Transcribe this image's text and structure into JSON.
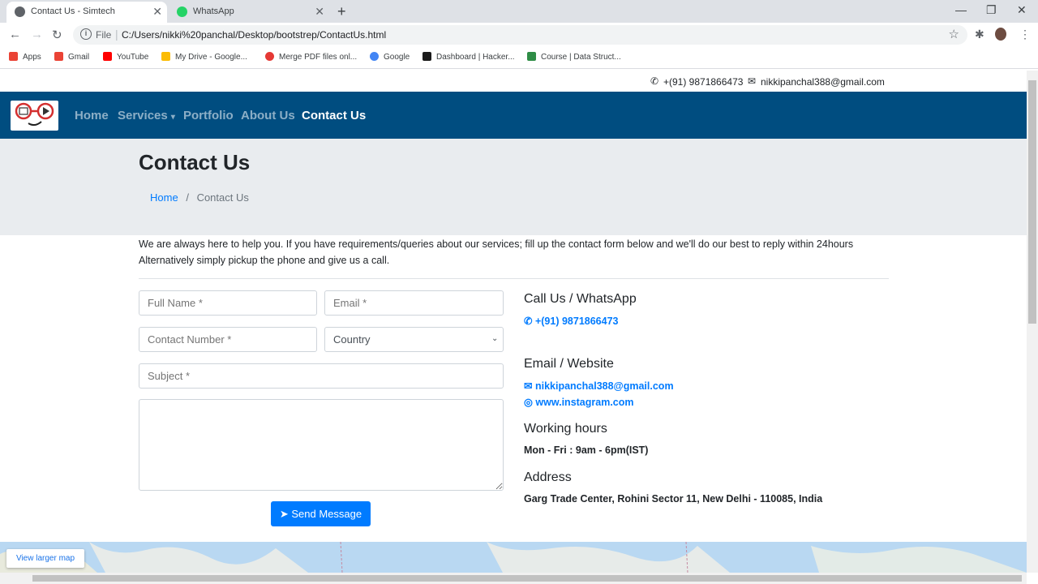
{
  "browser": {
    "tabs": [
      {
        "title": "Contact Us - Simtech",
        "active": true
      },
      {
        "title": "WhatsApp",
        "active": false
      }
    ],
    "url_scheme": "File",
    "url": "C:/Users/nikki%20panchal/Desktop/bootstrep/ContactUs.html",
    "bookmarks": [
      {
        "label": "Apps",
        "icon": "apps-grid-icon",
        "color": "#ea4335"
      },
      {
        "label": "Gmail",
        "icon": "gmail-icon",
        "color": "#ea4335"
      },
      {
        "label": "YouTube",
        "icon": "youtube-icon",
        "color": "#ff0000"
      },
      {
        "label": "My Drive - Google...",
        "icon": "google-drive-icon",
        "color": "#fbbc04"
      },
      {
        "label": "Merge PDF files onl...",
        "icon": "heart-icon",
        "color": "#e53935"
      },
      {
        "label": "Google",
        "icon": "google-icon",
        "color": "#4285f4"
      },
      {
        "label": "Dashboard | Hacker...",
        "icon": "hackerrank-icon",
        "color": "#1ba94c"
      },
      {
        "label": "Course | Data Struct...",
        "icon": "geeksforgeeks-icon",
        "color": "#2f8d46"
      }
    ]
  },
  "topbar": {
    "phone": "+(91) 9871866473",
    "email": "nikkipanchal388@gmail.com"
  },
  "nav": {
    "items": [
      "Home",
      "Services",
      "Portfolio",
      "About Us",
      "Contact Us"
    ],
    "active": "Contact Us",
    "bg_color": "#004d80"
  },
  "hero": {
    "title": "Contact Us",
    "breadcrumb_home": "Home",
    "breadcrumb_current": "Contact Us"
  },
  "intro": "We are always here to help you. If you have requirements/queries about our services; fill up the contact form below and we'll do our best to reply within 24hours Alternatively simply pickup the phone and give us a call.",
  "form": {
    "full_name_placeholder": "Full Name *",
    "email_placeholder": "Email *",
    "contact_placeholder": "Contact Number *",
    "country_selected": "Country",
    "subject_placeholder": "Subject *",
    "message_value": "",
    "send_label": "Send Message"
  },
  "contact_info": {
    "call_heading": "Call Us / WhatsApp",
    "phone": "+(91) 9871866473",
    "email_heading": "Email / Website",
    "email": "nikkipanchal388@gmail.com",
    "website": "www.instagram.com",
    "hours_heading": "Working hours",
    "hours": "Mon - Fri : 9am - 6pm(IST)",
    "address_heading": "Address",
    "address": "Garg Trade Center, Rohini Sector 11, New Delhi - 110085, India"
  },
  "map": {
    "view_larger": "View larger map"
  }
}
